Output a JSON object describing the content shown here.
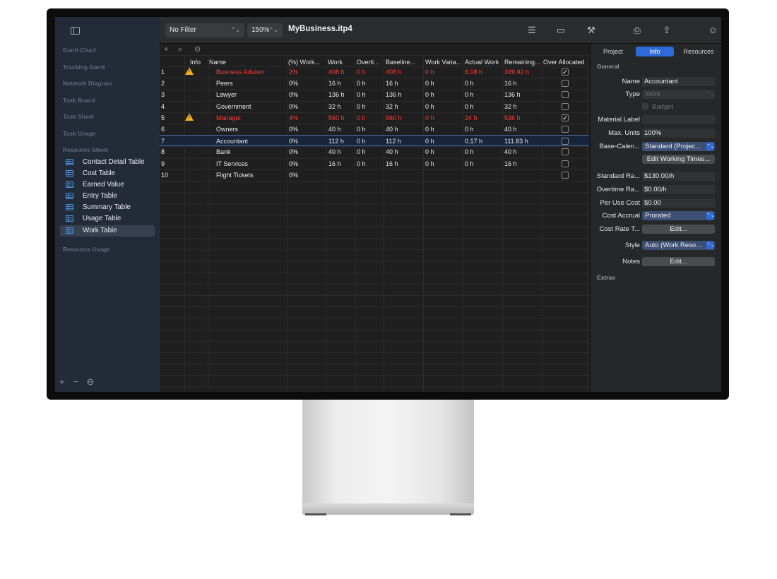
{
  "sidebar": {
    "views": [
      "Gantt Chart",
      "Tracking Gantt",
      "Network Diagram",
      "Task Board",
      "Task Sheet",
      "Task Usage"
    ],
    "resource_sheet_header": "Resource Sheet",
    "tables": [
      {
        "label": "Contact Detail Table"
      },
      {
        "label": "Cost Table"
      },
      {
        "label": "Earned Value"
      },
      {
        "label": "Entry Table"
      },
      {
        "label": "Summary Table"
      },
      {
        "label": "Usage Table"
      },
      {
        "label": "Work Table",
        "selected": true
      }
    ],
    "resource_usage": "Resource Usage",
    "bottom": {
      "add": "+",
      "remove": "−",
      "more": "⊖"
    }
  },
  "toolbar": {
    "filter": "No Filter",
    "zoom": "150%",
    "title": "MyBusiness.itp4",
    "icons": [
      "sliders-icon",
      "window-icon",
      "hammer-icon",
      "print-icon",
      "share-icon",
      "smiley-icon",
      "inspector-icon"
    ]
  },
  "table": {
    "tools": {
      "add": "+",
      "search": "⌕",
      "more": "⊖"
    },
    "columns": [
      "Info",
      "Name",
      "(%) Work...",
      "Work",
      "Overti...",
      "Baseline...",
      "Work Varia...",
      "Actual Work",
      "Remaining...",
      "Over Allocated"
    ],
    "rows": [
      {
        "num": "1",
        "warn": true,
        "red": true,
        "name": "Business Advisor",
        "pct": "2%",
        "work": "408 h",
        "overtime": "0 h",
        "baseline": "408 h",
        "variance": "0 h",
        "actual": "8.08 h",
        "remaining": "399.92 h",
        "over": true
      },
      {
        "num": "2",
        "name": "Peers",
        "pct": "0%",
        "work": "16 h",
        "overtime": "0 h",
        "baseline": "16 h",
        "variance": "0 h",
        "actual": "0 h",
        "remaining": "16 h",
        "over": false
      },
      {
        "num": "3",
        "name": "Lawyer",
        "pct": "0%",
        "work": "136 h",
        "overtime": "0 h",
        "baseline": "136 h",
        "variance": "0 h",
        "actual": "0 h",
        "remaining": "136 h",
        "over": false
      },
      {
        "num": "4",
        "name": "Government",
        "pct": "0%",
        "work": "32 h",
        "overtime": "0 h",
        "baseline": "32 h",
        "variance": "0 h",
        "actual": "0 h",
        "remaining": "32 h",
        "over": false
      },
      {
        "num": "5",
        "warn": true,
        "red": true,
        "name": "Manager",
        "pct": "4%",
        "work": "560 h",
        "overtime": "0 h",
        "baseline": "560 h",
        "variance": "0 h",
        "actual": "24 h",
        "remaining": "536 h",
        "over": true
      },
      {
        "num": "6",
        "name": "Owners",
        "pct": "0%",
        "work": "40 h",
        "overtime": "0 h",
        "baseline": "40 h",
        "variance": "0 h",
        "actual": "0 h",
        "remaining": "40 h",
        "over": false
      },
      {
        "num": "7",
        "selected": true,
        "name": "Accountant",
        "pct": "0%",
        "work": "112 h",
        "overtime": "0 h",
        "baseline": "112 h",
        "variance": "0 h",
        "actual": "0.17 h",
        "remaining": "111.83 h",
        "over": false
      },
      {
        "num": "8",
        "name": "Bank",
        "pct": "0%",
        "work": "40 h",
        "overtime": "0 h",
        "baseline": "40 h",
        "variance": "0 h",
        "actual": "0 h",
        "remaining": "40 h",
        "over": false
      },
      {
        "num": "9",
        "name": "IT Services",
        "pct": "0%",
        "work": "16 h",
        "overtime": "0 h",
        "baseline": "16 h",
        "variance": "0 h",
        "actual": "0 h",
        "remaining": "16 h",
        "over": false
      },
      {
        "num": "10",
        "name": "Flight Tickets",
        "pct": "0%",
        "work": "",
        "overtime": "",
        "baseline": "",
        "variance": "",
        "actual": "",
        "remaining": "",
        "over": false
      }
    ]
  },
  "inspector": {
    "tabs": [
      "Project",
      "Info",
      "Resources"
    ],
    "active_tab": "Info",
    "general": "General",
    "name_label": "Name",
    "name_value": "Accountant",
    "type_label": "Type",
    "type_value": "Work",
    "budget_label": "Budget",
    "material_label": "Material Label",
    "material_value": "",
    "max_units_label": "Max. Units",
    "max_units_value": "100%",
    "base_cal_label": "Base-Calen...",
    "base_cal_value": "Standard (Projec...",
    "edit_working_times": "Edit Working Times...",
    "std_rate_label": "Standard Ra...",
    "std_rate_value": "$130.00/h",
    "ot_rate_label": "Overtime Ra...",
    "ot_rate_value": "$0.00/h",
    "per_use_label": "Per Use Cost",
    "per_use_value": "$0.00",
    "accrual_label": "Cost Accrual",
    "accrual_value": "Prorated",
    "cost_rate_label": "Cost Rate T...",
    "cost_rate_button": "Edit...",
    "style_label": "Style",
    "style_value": "Auto (Work Reso...",
    "notes_label": "Notes",
    "notes_button": "Edit...",
    "extras": "Extras"
  }
}
